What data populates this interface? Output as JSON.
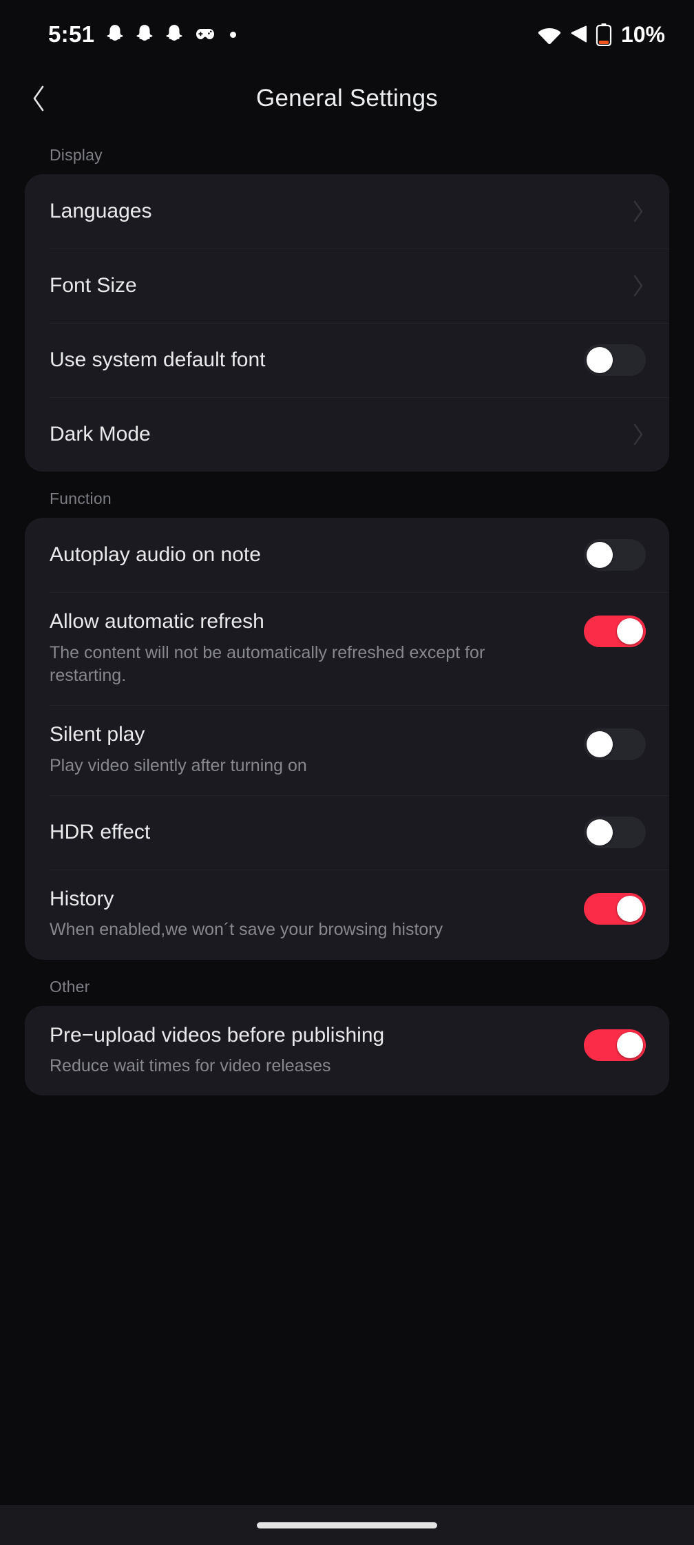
{
  "status_bar": {
    "time": "5:51",
    "left_icons": [
      "snapchat-ghost-icon",
      "snapchat-ghost-icon",
      "snapchat-ghost-icon",
      "game-controller-icon",
      "dot-icon"
    ],
    "right_icons": [
      "wifi-icon",
      "cellular-signal-icon",
      "battery-icon"
    ],
    "battery_percent": "10%"
  },
  "header": {
    "back_icon": "chevron-left-icon",
    "title": "General Settings"
  },
  "colors": {
    "accent_on": "#FB2C47",
    "page_bg": "#0B0B0D",
    "card_bg": "#1A1A20",
    "divider": "#232329",
    "title_text": "#E9EAEC",
    "subtitle_text": "#87888D",
    "section_label": "#7D7F85",
    "toggle_off_track": "#26262D",
    "toggle_knob": "#FFFFFF"
  },
  "sections": [
    {
      "label": "Display",
      "rows": [
        {
          "title": "Languages",
          "subtitle": "",
          "control": "chevron",
          "state": ""
        },
        {
          "title": "Font Size",
          "subtitle": "",
          "control": "chevron",
          "state": ""
        },
        {
          "title": "Use system default font",
          "subtitle": "",
          "control": "toggle",
          "state": "off"
        },
        {
          "title": "Dark Mode",
          "subtitle": "",
          "control": "chevron",
          "state": ""
        }
      ]
    },
    {
      "label": "Function",
      "rows": [
        {
          "title": "Autoplay audio on note",
          "subtitle": "",
          "control": "toggle",
          "state": "off"
        },
        {
          "title": "Allow automatic refresh",
          "subtitle": "The content will not be automatically refreshed except for restarting.",
          "control": "toggle",
          "state": "on"
        },
        {
          "title": "Silent play",
          "subtitle": "Play video silently after turning on",
          "control": "toggle",
          "state": "off"
        },
        {
          "title": "HDR effect",
          "subtitle": "",
          "control": "toggle",
          "state": "off"
        },
        {
          "title": "History",
          "subtitle": "When enabled,we won´t save your browsing history",
          "control": "toggle",
          "state": "on"
        }
      ]
    },
    {
      "label": "Other",
      "rows": [
        {
          "title": "Pre−upload videos before publishing",
          "subtitle": "Reduce wait times for video releases",
          "control": "toggle",
          "state": "on"
        }
      ]
    }
  ],
  "navbar": {
    "home_indicator": "home-indicator"
  }
}
